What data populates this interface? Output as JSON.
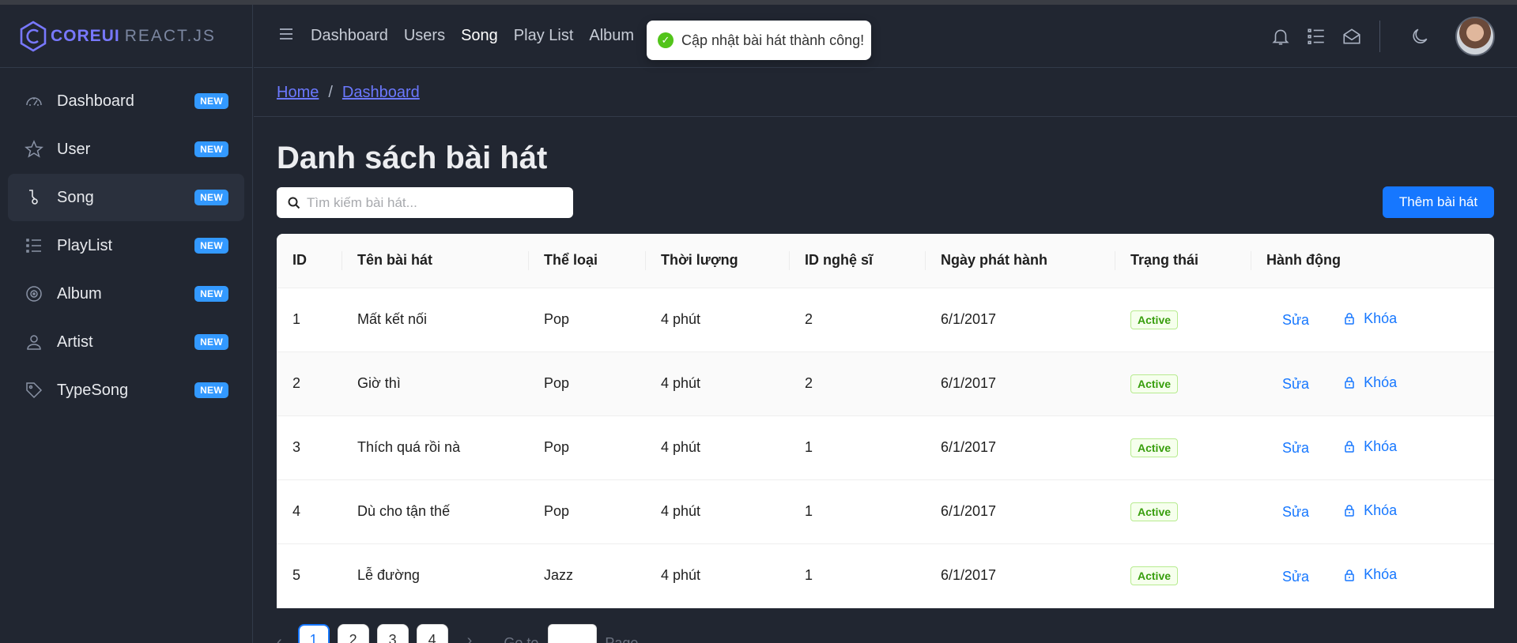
{
  "brand": {
    "core": "COREUI",
    "react": "REACT.JS"
  },
  "sidebar": {
    "items": [
      {
        "label": "Dashboard",
        "badge": "NEW",
        "icon": "speedometer-icon"
      },
      {
        "label": "User",
        "badge": "NEW",
        "icon": "star-icon"
      },
      {
        "label": "Song",
        "badge": "NEW",
        "icon": "puzzle-icon",
        "active": true
      },
      {
        "label": "PlayList",
        "badge": "NEW",
        "icon": "list-icon"
      },
      {
        "label": "Album",
        "badge": "NEW",
        "icon": "disc-icon"
      },
      {
        "label": "Artist",
        "badge": "NEW",
        "icon": "person-icon"
      },
      {
        "label": "TypeSong",
        "badge": "NEW",
        "icon": "tag-icon"
      }
    ]
  },
  "header": {
    "nav": [
      "Dashboard",
      "Users",
      "Song",
      "Play List",
      "Album"
    ],
    "active_nav": "Song",
    "icons": [
      "bell-icon",
      "list-icon",
      "envelope-icon",
      "moon-icon"
    ]
  },
  "toast": {
    "message": "Cập nhật bài hát thành công!",
    "color": "#52c41a"
  },
  "breadcrumb": {
    "home": "Home",
    "current": "Dashboard"
  },
  "main": {
    "title": "Danh sách bài hát",
    "search_placeholder": "Tìm kiếm bài hát...",
    "add_button": "Thêm bài hát",
    "columns": [
      "ID",
      "Tên bài hát",
      "Thể loại",
      "Thời lượng",
      "ID nghệ sĩ",
      "Ngày phát hành",
      "Trạng thái",
      "Hành động"
    ],
    "rows": [
      {
        "id": "1",
        "name": "Mất kết nối",
        "genre": "Pop",
        "duration": "4 phút",
        "artist_id": "2",
        "release": "6/1/2017",
        "status": "Active",
        "edit": "Sửa",
        "lock": "Khóa"
      },
      {
        "id": "2",
        "name": "Giờ thì",
        "genre": "Pop",
        "duration": "4 phút",
        "artist_id": "2",
        "release": "6/1/2017",
        "status": "Active",
        "edit": "Sửa",
        "lock": "Khóa"
      },
      {
        "id": "3",
        "name": "Thích quá rồi nà",
        "genre": "Pop",
        "duration": "4 phút",
        "artist_id": "1",
        "release": "6/1/2017",
        "status": "Active",
        "edit": "Sửa",
        "lock": "Khóa"
      },
      {
        "id": "4",
        "name": "Dù cho tận thế",
        "genre": "Pop",
        "duration": "4 phút",
        "artist_id": "1",
        "release": "6/1/2017",
        "status": "Active",
        "edit": "Sửa",
        "lock": "Khóa"
      },
      {
        "id": "5",
        "name": "Lễ đường",
        "genre": "Jazz",
        "duration": "4 phút",
        "artist_id": "1",
        "release": "6/1/2017",
        "status": "Active",
        "edit": "Sửa",
        "lock": "Khóa"
      }
    ]
  },
  "pagination": {
    "pages": [
      "1",
      "2",
      "3",
      "4"
    ],
    "current": "1",
    "goto_label": "Go to",
    "page_label": "Page"
  },
  "colors": {
    "accent": "#1677ff",
    "link": "#6b78ff",
    "badge": "#3399ff",
    "bg": "#212631",
    "status_green": "#389e0d"
  }
}
